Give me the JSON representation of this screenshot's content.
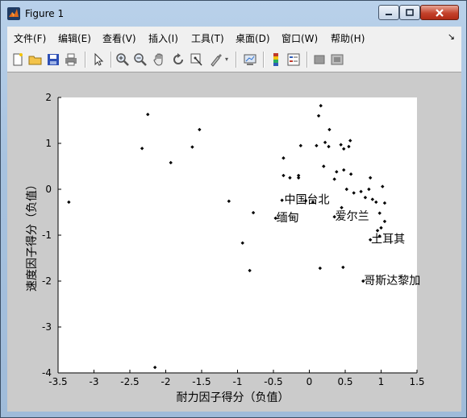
{
  "window": {
    "title": "Figure 1",
    "controls": [
      "minimize",
      "maximize",
      "close"
    ]
  },
  "menu": {
    "items": [
      "文件(F)",
      "编辑(E)",
      "查看(V)",
      "插入(I)",
      "工具(T)",
      "桌面(D)",
      "窗口(W)",
      "帮助(H)"
    ],
    "overflow_icon": "dock-arrow-icon"
  },
  "toolbar": {
    "icons": [
      "new-figure-icon",
      "open-file-icon",
      "save-icon",
      "print-icon",
      "pointer-icon",
      "zoom-in-icon",
      "zoom-out-icon",
      "pan-hand-icon",
      "rotate-3d-icon",
      "data-cursor-icon",
      "brush-icon",
      "link-plot-icon",
      "colorbar-icon",
      "legend-icon",
      "hide-plot-tools-icon",
      "show-plot-tools-icon"
    ]
  },
  "chart_data": {
    "type": "scatter",
    "title": "",
    "xlabel": "耐力因子得分（负值）",
    "ylabel": "速度因子得分（负值）",
    "xlim": [
      -3.5,
      1.5
    ],
    "ylim": [
      -4,
      2
    ],
    "xticks": [
      "-3.5",
      "-3",
      "-2.5",
      "-2",
      "-1.5",
      "-1",
      "-0.5",
      "0",
      "0.5",
      "1",
      "1.5"
    ],
    "yticks": [
      "-4",
      "-3",
      "-2",
      "-1",
      "0",
      "1",
      "2"
    ],
    "grid": false,
    "marker_color": "#000000",
    "points": [
      [
        -3.35,
        -0.28
      ],
      [
        -2.25,
        1.63
      ],
      [
        -2.33,
        0.89
      ],
      [
        -1.93,
        0.58
      ],
      [
        -1.53,
        1.3
      ],
      [
        -1.63,
        0.92
      ],
      [
        -1.12,
        -0.26
      ],
      [
        -0.78,
        -0.51
      ],
      [
        -0.93,
        -1.17
      ],
      [
        -0.83,
        -1.77
      ],
      [
        -2.15,
        -3.88
      ],
      [
        -0.47,
        -0.63
      ],
      [
        -0.38,
        -0.24
      ],
      [
        -0.36,
        0.3
      ],
      [
        -0.36,
        0.68
      ],
      [
        -0.27,
        0.25
      ],
      [
        -0.15,
        0.3
      ],
      [
        -0.15,
        0.25
      ],
      [
        -0.12,
        0.95
      ],
      [
        0.05,
        -0.28
      ],
      [
        0.1,
        0.95
      ],
      [
        0.13,
        1.6
      ],
      [
        0.16,
        1.82
      ],
      [
        0.2,
        0.5
      ],
      [
        0.22,
        1.02
      ],
      [
        0.27,
        0.93
      ],
      [
        0.28,
        1.3
      ],
      [
        0.38,
        0.38
      ],
      [
        0.35,
        0.22
      ],
      [
        0.44,
        0.97
      ],
      [
        0.48,
        0.88
      ],
      [
        0.48,
        0.42
      ],
      [
        0.55,
        0.93
      ],
      [
        0.57,
        1.06
      ],
      [
        0.58,
        0.33
      ],
      [
        0.52,
        0.0
      ],
      [
        0.62,
        -0.08
      ],
      [
        0.72,
        -0.05
      ],
      [
        0.78,
        -0.18
      ],
      [
        0.83,
        0.0
      ],
      [
        0.85,
        0.25
      ],
      [
        0.88,
        -0.22
      ],
      [
        0.93,
        -0.28
      ],
      [
        0.98,
        -0.52
      ],
      [
        1.02,
        0.06
      ],
      [
        1.05,
        -0.3
      ],
      [
        1.05,
        -0.7
      ],
      [
        0.95,
        -0.9
      ],
      [
        0.85,
        -1.1
      ],
      [
        0.98,
        -1.02
      ],
      [
        1.0,
        -0.84
      ],
      [
        0.35,
        -0.6
      ],
      [
        0.45,
        -0.4
      ],
      [
        0.15,
        -1.72
      ],
      [
        0.47,
        -1.7
      ],
      [
        0.75,
        -2.0
      ],
      [
        -0.05,
        -0.25
      ]
    ],
    "annotations": [
      {
        "text": "中国台北",
        "x": -0.36,
        "y": -0.24
      },
      {
        "text": "缅甸",
        "x": -0.47,
        "y": -0.63
      },
      {
        "text": "爱尔兰",
        "x": 0.35,
        "y": -0.6
      },
      {
        "text": "土耳其",
        "x": 0.85,
        "y": -1.1
      },
      {
        "text": "哥斯达黎加",
        "x": 0.75,
        "y": -2.0
      }
    ]
  }
}
